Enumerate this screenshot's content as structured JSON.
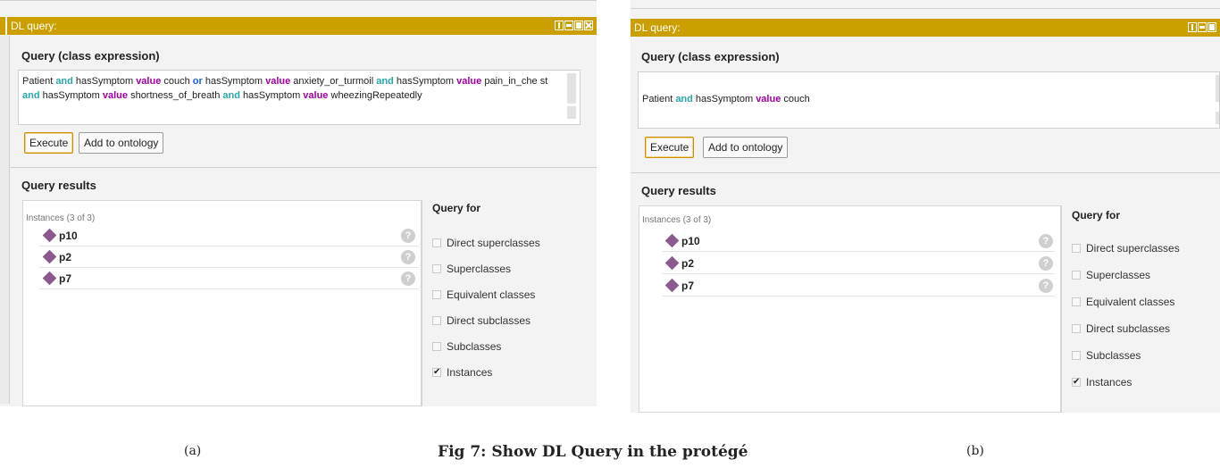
{
  "panels": [
    {
      "title": "DL query:",
      "query_section_label": "Query (class expression)",
      "query_tokens": [
        {
          "t": "Patient ",
          "k": ""
        },
        {
          "t": "and",
          "k": "and"
        },
        {
          "t": " hasSymptom ",
          "k": ""
        },
        {
          "t": "value",
          "k": "value"
        },
        {
          "t": " couch ",
          "k": ""
        },
        {
          "t": "or",
          "k": "or"
        },
        {
          "t": " hasSymptom ",
          "k": ""
        },
        {
          "t": "value",
          "k": "value"
        },
        {
          "t": " anxiety_or_turmoil  ",
          "k": ""
        },
        {
          "t": "and",
          "k": "and"
        },
        {
          "t": " hasSymptom ",
          "k": ""
        },
        {
          "t": "value",
          "k": "value"
        },
        {
          "t": " pain_in_che st  ",
          "k": ""
        },
        {
          "t": "and",
          "k": "and"
        },
        {
          "t": " hasSymptom ",
          "k": ""
        },
        {
          "t": "value",
          "k": "value"
        },
        {
          "t": " shortness_of_breath  ",
          "k": ""
        },
        {
          "t": "and",
          "k": "and"
        },
        {
          "t": " hasSymptom ",
          "k": ""
        },
        {
          "t": "value",
          "k": "value"
        },
        {
          "t": " wheezingRepeatedly",
          "k": ""
        }
      ],
      "execute_label": "Execute",
      "add_label": "Add to ontology",
      "results_section_label": "Query results",
      "results_count": "Instances (3 of 3)",
      "instances": [
        "p10",
        "p2",
        "p7"
      ],
      "help_glyph": "?",
      "query_for_title": "Query for",
      "options": [
        {
          "label": "Direct superclasses",
          "checked": false
        },
        {
          "label": "Superclasses",
          "checked": false
        },
        {
          "label": "Equivalent classes",
          "checked": false
        },
        {
          "label": "Direct subclasses",
          "checked": false
        },
        {
          "label": "Subclasses",
          "checked": false
        },
        {
          "label": "Instances",
          "checked": true
        }
      ]
    },
    {
      "title": "DL query:",
      "query_section_label": "Query (class expression)",
      "query_tokens": [
        {
          "t": "Patient ",
          "k": ""
        },
        {
          "t": "and",
          "k": "and"
        },
        {
          "t": " hasSymptom ",
          "k": ""
        },
        {
          "t": "value",
          "k": "value"
        },
        {
          "t": " couch",
          "k": ""
        }
      ],
      "execute_label": "Execute",
      "add_label": "Add to ontology",
      "results_section_label": "Query results",
      "results_count": "Instances (3 of 3)",
      "instances": [
        "p10",
        "p2",
        "p7"
      ],
      "help_glyph": "?",
      "query_for_title": "Query for",
      "options": [
        {
          "label": "Direct superclasses",
          "checked": false
        },
        {
          "label": "Superclasses",
          "checked": false
        },
        {
          "label": "Equivalent classes",
          "checked": false
        },
        {
          "label": "Direct subclasses",
          "checked": false
        },
        {
          "label": "Subclasses",
          "checked": false
        },
        {
          "label": "Instances",
          "checked": true
        }
      ]
    }
  ],
  "captions": {
    "a": "(a)",
    "figure": "Fig 7: Show DL Query in the protégé",
    "b": "(b)"
  },
  "check_glyph": "✔",
  "colors": {
    "title_bar": "#cc9f00",
    "kw_and": "#2aa6a6",
    "kw_value": "#a000a0",
    "kw_or": "#1d5fd3",
    "instance_diamond": "#8a5a8e"
  }
}
